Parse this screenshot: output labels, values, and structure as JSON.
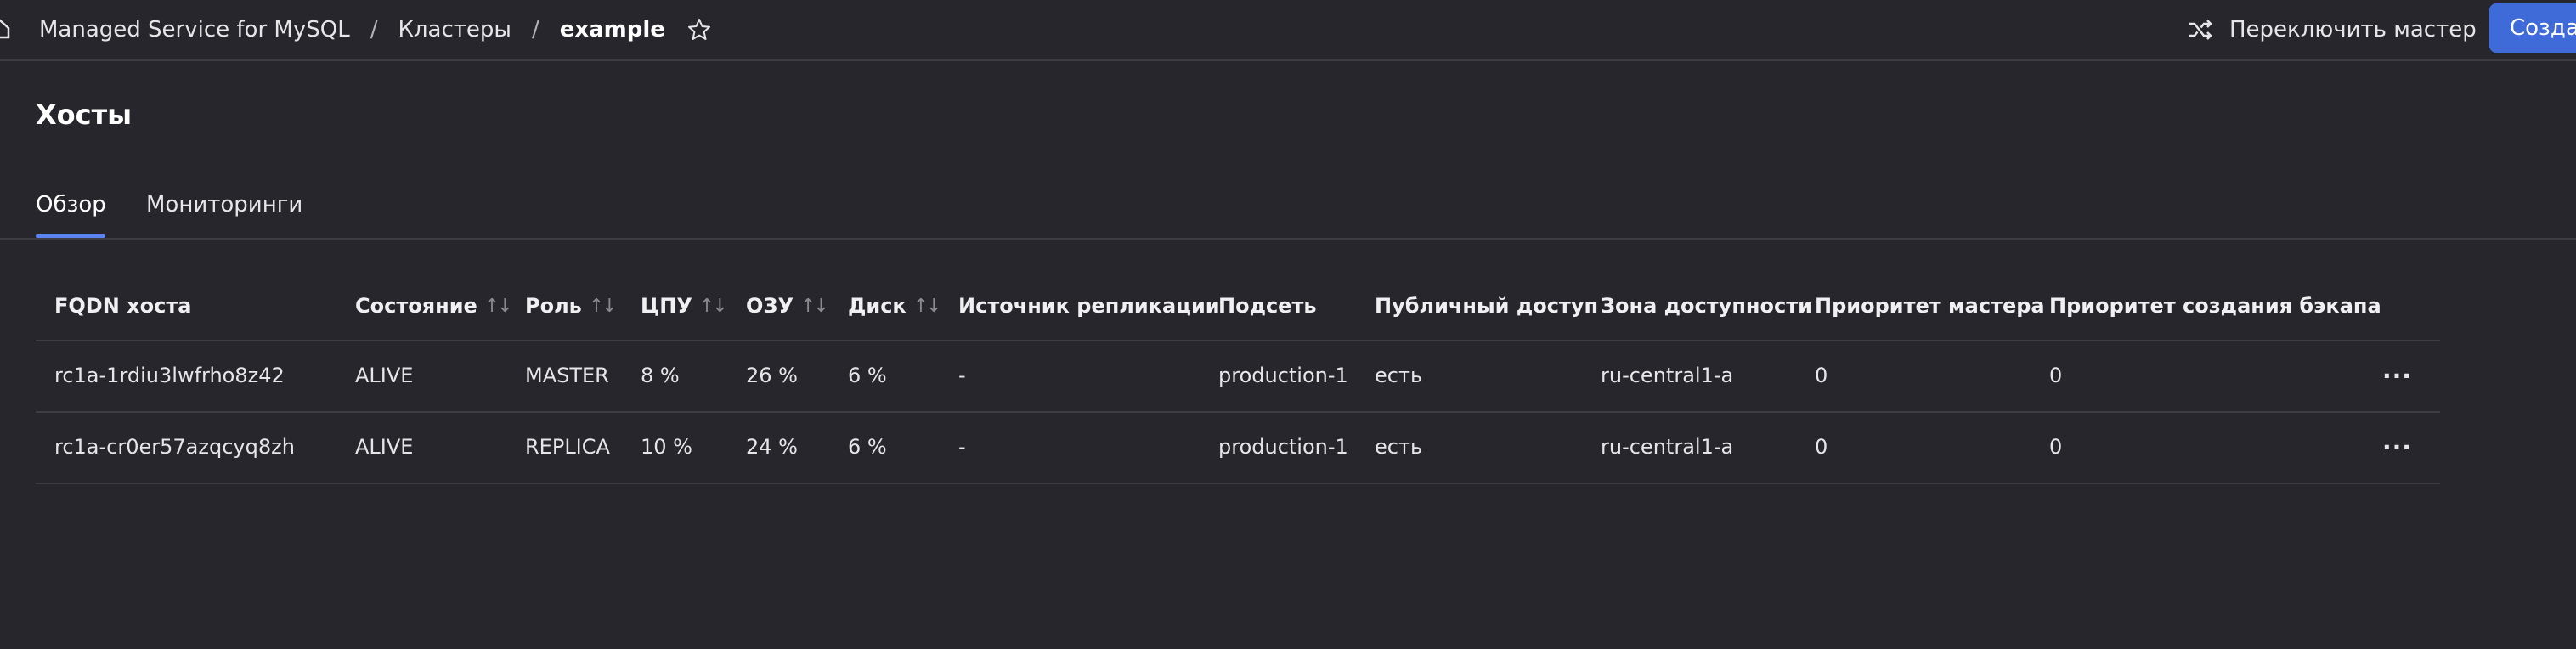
{
  "breadcrumbs": {
    "service": "Managed Service for MySQL",
    "clusters": "Кластеры",
    "current": "example",
    "separator": "/"
  },
  "header": {
    "switch_master_label": "Переключить мастер",
    "create_label": "Создат"
  },
  "page": {
    "title": "Хосты"
  },
  "tabs": [
    {
      "label": "Обзор",
      "active": true
    },
    {
      "label": "Мониторинги",
      "active": false
    }
  ],
  "table": {
    "columns": [
      "FQDN хоста",
      "Состояние",
      "Роль",
      "ЦПУ",
      "ОЗУ",
      "Диск",
      "Источник репликации",
      "Подсеть",
      "Публичный доступ",
      "Зона доступности",
      "Приоритет мастера",
      "Приоритет создания бэкапа"
    ],
    "rows": [
      {
        "fqdn": "rc1a-1rdiu3lwfrho8z42",
        "status": "ALIVE",
        "role": "MASTER",
        "cpu": "8 %",
        "ram": "26 %",
        "disk": "6 %",
        "repl_source": "-",
        "subnet": "production-1",
        "public_access": "есть",
        "zone": "ru-central1-a",
        "master_priority": "0",
        "backup_priority": "0"
      },
      {
        "fqdn": "rc1a-cr0er57azqcyq8zh",
        "status": "ALIVE",
        "role": "REPLICA",
        "cpu": "10 %",
        "ram": "24 %",
        "disk": "6 %",
        "repl_source": "-",
        "subnet": "production-1",
        "public_access": "есть",
        "zone": "ru-central1-a",
        "master_priority": "0",
        "backup_priority": "0"
      }
    ],
    "actions_label": "···"
  },
  "colors": {
    "background": "#27262c",
    "accent": "#3f6bd8",
    "status_alive": "#6fbf45",
    "link": "#5b8cff"
  },
  "icons": {
    "home": "home-icon",
    "star": "star-icon",
    "switch": "shuffle-icon",
    "sort": "sort-arrows-icon",
    "actions": "more-dots-icon"
  }
}
